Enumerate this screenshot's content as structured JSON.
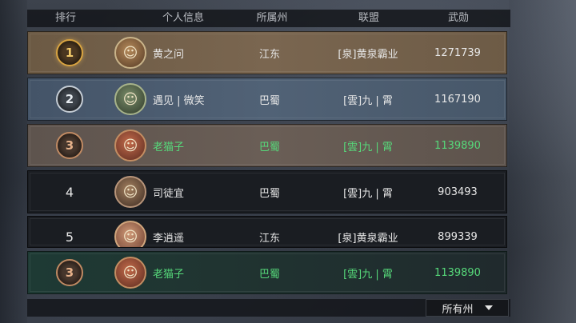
{
  "header": {
    "rank": "排行",
    "personal_info": "个人信息",
    "state": "所属州",
    "alliance": "联盟",
    "merit": "武勋"
  },
  "rows": [
    {
      "rank": "1",
      "name": "黄之问",
      "state": "江东",
      "alliance": "[泉]黄泉霸业",
      "merit": "1271739",
      "avatar_icon": "general-portrait-icon"
    },
    {
      "rank": "2",
      "name": "遇见 | 微笑",
      "state": "巴蜀",
      "alliance": "[雲]九 | 霄",
      "merit": "1167190",
      "avatar_icon": "general-portrait-icon"
    },
    {
      "rank": "3",
      "name": "老猫子",
      "state": "巴蜀",
      "alliance": "[雲]九 | 霄",
      "merit": "1139890",
      "avatar_icon": "general-portrait-icon"
    },
    {
      "rank": "4",
      "name": "司徒宜",
      "state": "巴蜀",
      "alliance": "[雲]九 | 霄",
      "merit": "903493",
      "avatar_icon": "general-portrait-icon"
    },
    {
      "rank": "5",
      "name": "李逍遥",
      "state": "江东",
      "alliance": "[泉]黄泉霸业",
      "merit": "899339",
      "avatar_icon": "general-portrait-icon"
    }
  ],
  "self_row": {
    "rank": "3",
    "name": "老猫子",
    "state": "巴蜀",
    "alliance": "[雲]九 | 霄",
    "merit": "1139890"
  },
  "filter": {
    "label": "所有州"
  },
  "colors": {
    "highlight_green": "#56d97a",
    "gold_rank": "#d9a441",
    "silver_rank": "#c4ccd4",
    "bronze_rank": "#c08a63"
  }
}
